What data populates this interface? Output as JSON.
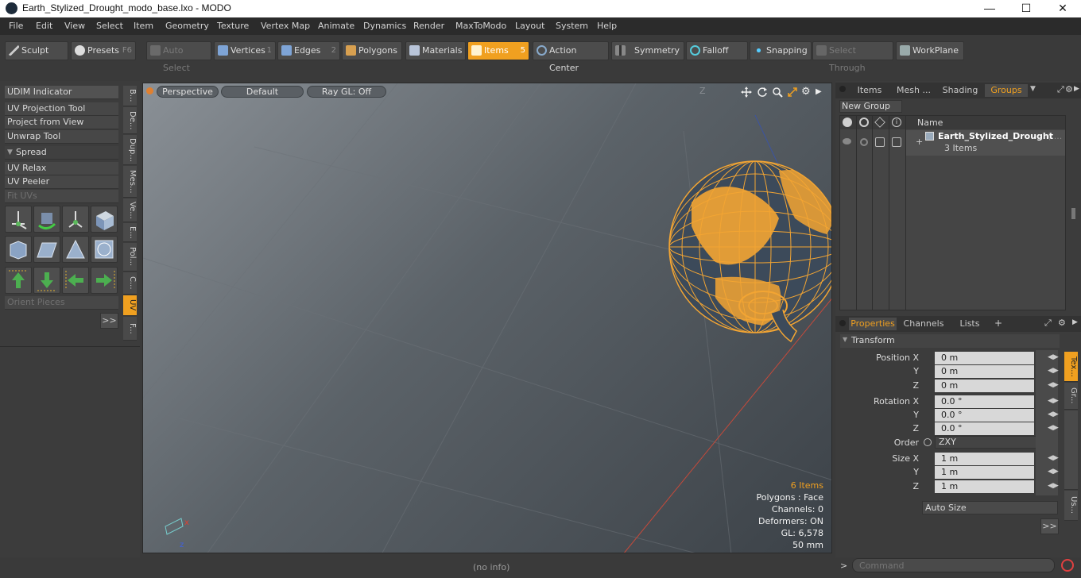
{
  "window": {
    "title": "Earth_Stylized_Drought_modo_base.lxo - MODO",
    "minimize": "—",
    "maximize": "☐",
    "close": "✕"
  },
  "menu": [
    "File",
    "Edit",
    "View",
    "Select",
    "Item",
    "Geometry",
    "Texture",
    "Vertex Map",
    "Animate",
    "Dynamics",
    "Render",
    "MaxToModo",
    "Layout",
    "System",
    "Help"
  ],
  "toolbar": {
    "sculpt": "Sculpt",
    "presets": "Presets",
    "presets_key": "F6",
    "auto_select": "Auto Select",
    "vertices": "Vertices",
    "vertices_key": "1",
    "edges": "Edges",
    "edges_key": "2",
    "polygons": "Polygons",
    "materials": "Materials",
    "items": "Items",
    "items_key": "5",
    "action_center": "Action Center",
    "symmetry": "Symmetry",
    "falloff": "Falloff",
    "snapping": "Snapping",
    "select_through": "Select Through",
    "workplane": "WorkPlane"
  },
  "left": {
    "buttons": [
      "UDIM Indicator",
      "UV Projection Tool",
      "Project from View",
      "Unwrap Tool"
    ],
    "spread": "Spread",
    "buttons2": [
      "UV Relax",
      "UV Peeler",
      "Fit UVs"
    ],
    "orient": "Orient Pieces",
    "more": ">>",
    "vtabs": [
      "B...",
      "De...",
      "Dup...",
      "Mes...",
      "Ve...",
      "E...",
      "Pol...",
      "C...",
      "UV",
      "F..."
    ]
  },
  "viewport": {
    "perspective": "Perspective",
    "default": "Default",
    "raygl": "Ray GL: Off",
    "axis_hint": "Z",
    "stats": {
      "items": "6 Items",
      "polygons": "Polygons : Face",
      "channels": "Channels: 0",
      "deformers": "Deformers: ON",
      "gl": "GL: 6,578",
      "mm": "50 mm"
    }
  },
  "right": {
    "tabs": [
      "Items",
      "Mesh ...",
      "Shading",
      "Groups"
    ],
    "new_group": "New Group",
    "col_name": "Name",
    "group_name": "Earth_Stylized_Drought",
    "group_ellipsis": "( ...",
    "group_items": "3 Items",
    "prop_tabs": [
      "Properties",
      "Channels",
      "Lists"
    ],
    "plus": "+",
    "transform": "Transform",
    "labels": {
      "px": "Position X",
      "y": "Y",
      "z": "Z",
      "rx": "Rotation X",
      "order": "Order",
      "sx": "Size X"
    },
    "values": {
      "px": "0 m",
      "py": "0 m",
      "pz": "0 m",
      "rx": "0.0 °",
      "ry": "0.0 °",
      "rz": "0.0 °",
      "order": "ZXY",
      "sx": "1 m",
      "sy": "1 m",
      "sz": "1 m"
    },
    "auto_size": "Auto Size",
    "more": ">>",
    "side_tabs": [
      "Tex...",
      "Gr...",
      "Us..."
    ]
  },
  "status": {
    "info": "(no info)",
    "command_placeholder": "Command",
    "prompt": ">"
  },
  "colors": {
    "accent": "#f0a020",
    "wire": "#f3a533",
    "panel": "#3c3c3c"
  }
}
